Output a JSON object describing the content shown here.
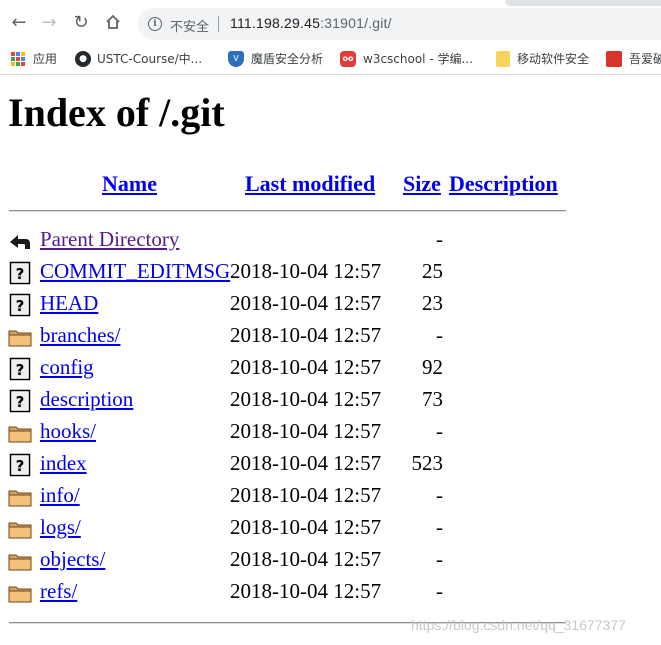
{
  "browser": {
    "security_label": "不安全",
    "url_host": "111.198.29.45",
    "url_rest": ":31901/.git/"
  },
  "bookmarks": [
    {
      "label": "应用",
      "icon": "apps-grid-icon"
    },
    {
      "label": "USTC-Course/中...",
      "icon": "github-icon"
    },
    {
      "label": "魔盾安全分析",
      "icon": "shield-icon"
    },
    {
      "label": "w3cschool - 学编...",
      "icon": "owl-icon"
    },
    {
      "label": "移动软件安全",
      "icon": "folder-icon"
    },
    {
      "label": "吾爱破",
      "icon": "red-square-icon"
    }
  ],
  "page": {
    "title": "Index of /.git",
    "columns": {
      "name": "Name",
      "last_modified": "Last modified",
      "size": "Size",
      "description": "Description"
    },
    "entries": [
      {
        "name": "Parent Directory",
        "date": "",
        "size": "-",
        "icon": "back-arrow-icon",
        "visited": true
      },
      {
        "name": "COMMIT_EDITMSG",
        "date": "2018-10-04 12:57",
        "size": "25",
        "icon": "unknown-file-icon"
      },
      {
        "name": "HEAD",
        "date": "2018-10-04 12:57",
        "size": "23",
        "icon": "unknown-file-icon"
      },
      {
        "name": "branches/",
        "date": "2018-10-04 12:57",
        "size": "-",
        "icon": "folder-icon"
      },
      {
        "name": "config",
        "date": "2018-10-04 12:57",
        "size": "92",
        "icon": "unknown-file-icon"
      },
      {
        "name": "description",
        "date": "2018-10-04 12:57",
        "size": "73",
        "icon": "unknown-file-icon"
      },
      {
        "name": "hooks/",
        "date": "2018-10-04 12:57",
        "size": "-",
        "icon": "folder-icon"
      },
      {
        "name": "index",
        "date": "2018-10-04 12:57",
        "size": "523",
        "icon": "unknown-file-icon"
      },
      {
        "name": "info/",
        "date": "2018-10-04 12:57",
        "size": "-",
        "icon": "folder-icon"
      },
      {
        "name": "logs/",
        "date": "2018-10-04 12:57",
        "size": "-",
        "icon": "folder-icon"
      },
      {
        "name": "objects/",
        "date": "2018-10-04 12:57",
        "size": "-",
        "icon": "folder-icon"
      },
      {
        "name": "refs/",
        "date": "2018-10-04 12:57",
        "size": "-",
        "icon": "folder-icon"
      }
    ],
    "watermark": "https://blog.csdn.net/qq_31677377"
  }
}
